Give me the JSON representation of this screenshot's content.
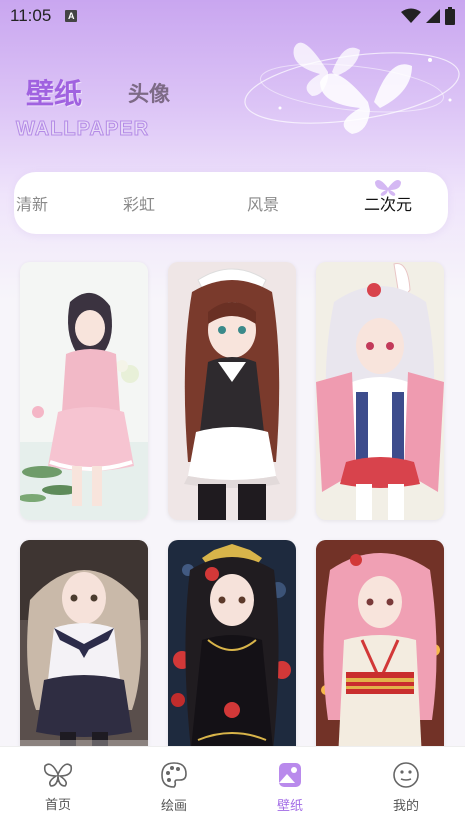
{
  "status_bar": {
    "time": "11:05",
    "notification_letter": "A"
  },
  "header": {
    "title_active": "壁纸",
    "title_inactive": "头像",
    "title_english": "WALLPAPER"
  },
  "categories": {
    "items": [
      {
        "label": "清新"
      },
      {
        "label": "彩虹"
      },
      {
        "label": "风景"
      },
      {
        "label": "二次元"
      }
    ],
    "active_index": 3
  },
  "wallpapers": [
    {
      "icon": "wallpaper-girl-pink-dress"
    },
    {
      "icon": "wallpaper-girl-maid"
    },
    {
      "icon": "wallpaper-girl-bunny-ears"
    },
    {
      "icon": "wallpaper-girl-sailor-uniform"
    },
    {
      "icon": "wallpaper-girl-black-gown"
    },
    {
      "icon": "wallpaper-girl-kimono"
    }
  ],
  "bottom_nav": {
    "items": [
      {
        "label": "首页",
        "icon": "butterfly-icon"
      },
      {
        "label": "绘画",
        "icon": "palette-icon"
      },
      {
        "label": "壁纸",
        "icon": "image-icon"
      },
      {
        "label": "我的",
        "icon": "smiley-icon"
      }
    ],
    "active_index": 2
  },
  "colors": {
    "accent": "#a26be6",
    "title_purple": "#a062e0",
    "header_gradient_top": "#c9a6f0"
  }
}
